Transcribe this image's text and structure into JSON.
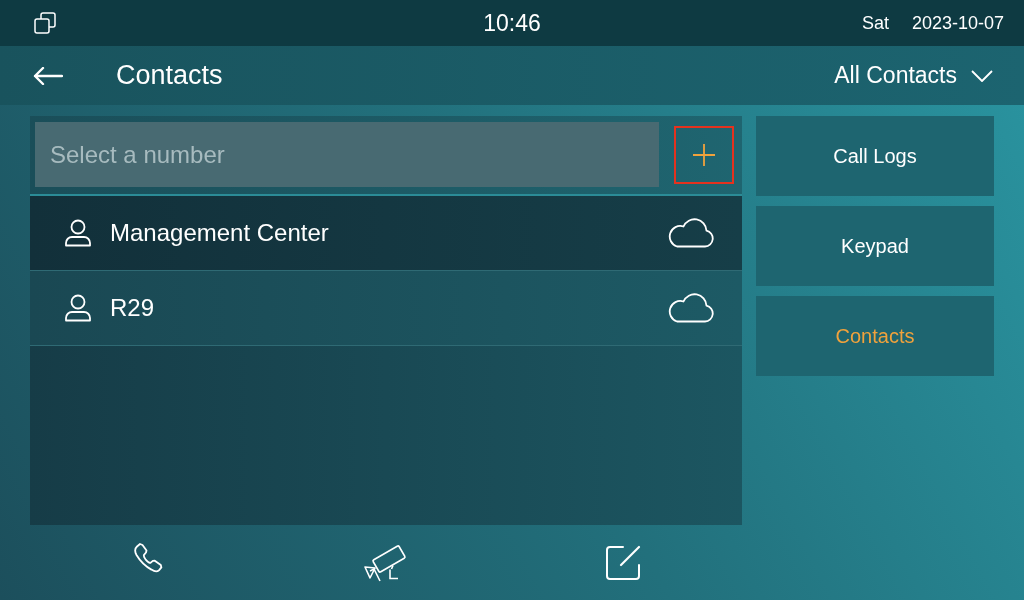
{
  "status_bar": {
    "time": "10:46",
    "day": "Sat",
    "date": "2023-10-07"
  },
  "header": {
    "title": "Contacts",
    "filter": "All Contacts"
  },
  "search": {
    "placeholder": "Select a number"
  },
  "add_button": {
    "highlighted": true
  },
  "contacts": [
    {
      "name": "Management Center",
      "selected": true
    },
    {
      "name": "R29",
      "selected": false
    }
  ],
  "nav": [
    {
      "label": "Call Logs",
      "selected": false
    },
    {
      "label": "Keypad",
      "selected": false
    },
    {
      "label": "Contacts",
      "selected": true
    }
  ]
}
